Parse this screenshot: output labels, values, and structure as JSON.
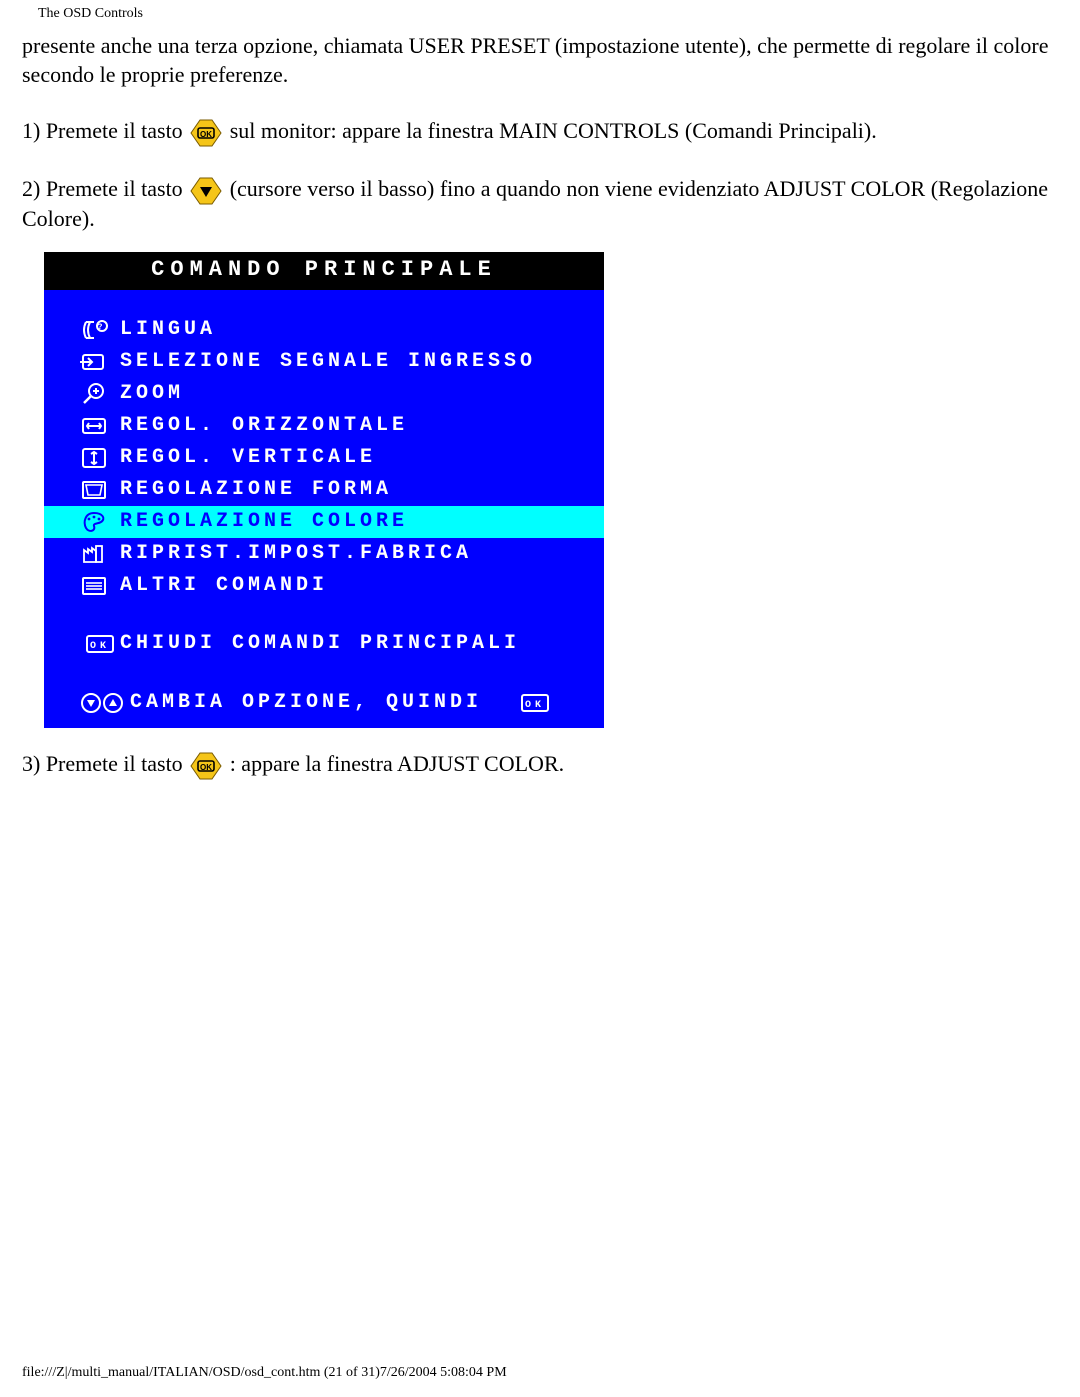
{
  "header": {
    "title": "The OSD Controls"
  },
  "paragraphs": {
    "intro": "presente anche una terza opzione, chiamata USER PRESET (impostazione utente), che permette di regolare il colore secondo le proprie preferenze.",
    "step1_pre": "1) Premete il tasto ",
    "step1_post": " sul monitor: appare la finestra MAIN CONTROLS (Comandi Principali).",
    "step2_pre": "2) Premete il tasto ",
    "step2_post": " (cursore verso il basso) fino a quando non viene evidenziato ADJUST COLOR (Regolazione Colore).",
    "step3_pre": "3) Premete il tasto ",
    "step3_post": " : appare la finestra ADJUST COLOR."
  },
  "osd": {
    "title": "COMANDO PRINCIPALE",
    "items": [
      {
        "label": "LINGUA"
      },
      {
        "label": "SELEZIONE SEGNALE INGRESSO"
      },
      {
        "label": "ZOOM"
      },
      {
        "label": "REGOL. ORIZZONTALE"
      },
      {
        "label": "REGOL. VERTICALE"
      },
      {
        "label": "REGOLAZIONE FORMA"
      },
      {
        "label": "REGOLAZIONE COLORE"
      },
      {
        "label": "RIPRIST.IMPOST.FABRICA"
      },
      {
        "label": "ALTRI COMANDI"
      }
    ],
    "close_label": "CHIUDI COMANDI PRINCIPALI",
    "footer_label": "CAMBIA OPZIONE, QUINDI"
  },
  "footer": {
    "text": "file:///Z|/multi_manual/ITALIAN/OSD/osd_cont.htm (21 of 31)7/26/2004 5:08:04 PM"
  },
  "icons": {
    "ok_button": "OK",
    "down_button": "▼"
  }
}
